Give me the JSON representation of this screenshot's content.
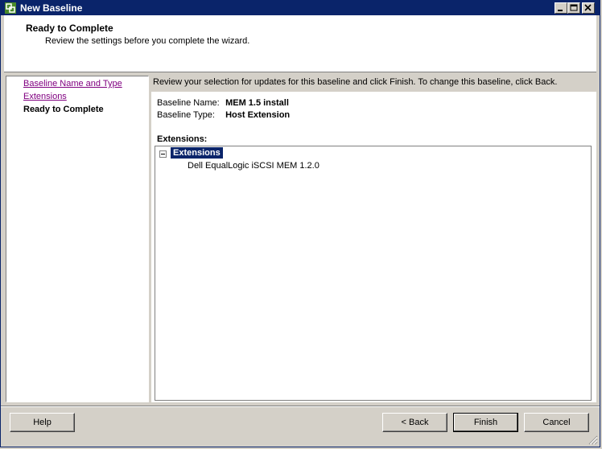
{
  "window": {
    "title": "New Baseline"
  },
  "header": {
    "title": "Ready to Complete",
    "subtitle": "Review the settings before you complete the wizard."
  },
  "nav": {
    "steps": [
      {
        "label": "Baseline Name and Type",
        "state": "visited"
      },
      {
        "label": "Extensions",
        "state": "visited"
      },
      {
        "label": "Ready to Complete",
        "state": "current"
      }
    ]
  },
  "content": {
    "intro": "Review your selection for updates for this baseline and click Finish. To change this baseline, click Back.",
    "fields": [
      {
        "label": "Baseline Name:",
        "value": "MEM 1.5 install"
      },
      {
        "label": "Baseline Type:",
        "value": "Host Extension"
      }
    ],
    "extensions_label": "Extensions:",
    "tree": {
      "root": "Extensions",
      "children": [
        "Dell EqualLogic iSCSI MEM 1.2.0"
      ]
    }
  },
  "footer": {
    "help": "Help",
    "back": "< Back",
    "finish": "Finish",
    "cancel": "Cancel"
  },
  "colors": {
    "titlebar": "#0a246a",
    "selection": "#0a246a",
    "visited_link": "#800080",
    "face": "#d4d0c8"
  }
}
